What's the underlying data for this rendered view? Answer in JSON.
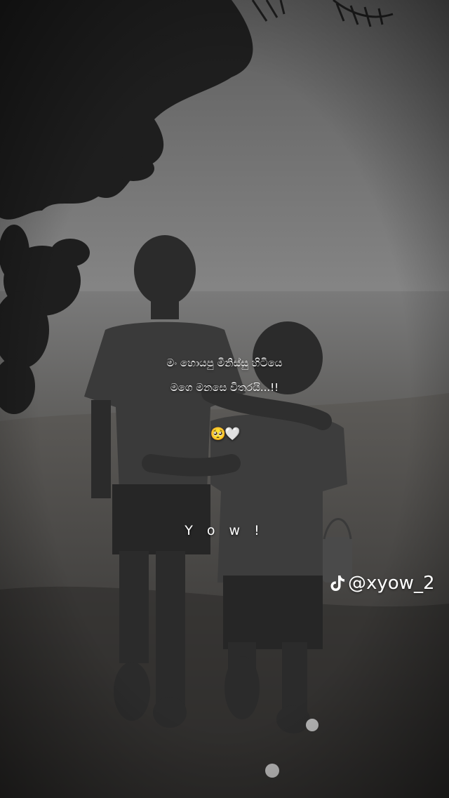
{
  "caption": {
    "line1": "මං හොයපු මිනිස්සු හිටියෙ",
    "line2": "මගෙ මනසෙ විතරයි...!!",
    "emoji": "🥺🤍"
  },
  "signature_text": "Y o w !",
  "watermark": {
    "icon": "tiktok-icon",
    "handle": "@xyow_2"
  },
  "palette": {
    "sky": "#7a7a7a",
    "sea": "#6a6a6a",
    "sand": "#4a4846",
    "figures": "#2a2a2a"
  }
}
